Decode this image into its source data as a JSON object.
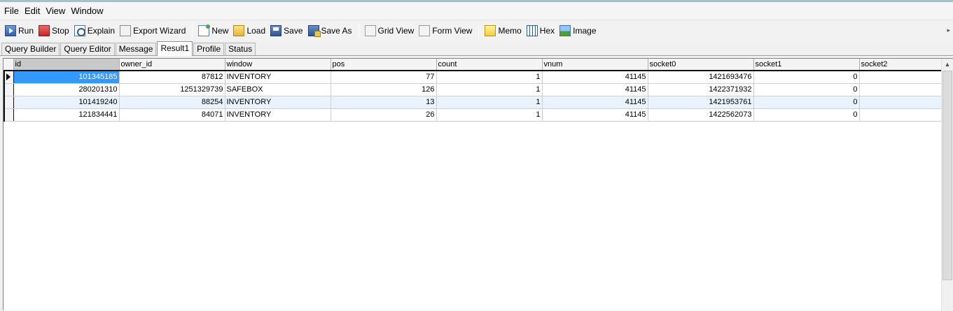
{
  "menu": [
    "File",
    "Edit",
    "View",
    "Window"
  ],
  "toolbar": {
    "run": "Run",
    "stop": "Stop",
    "explain": "Explain",
    "export_wizard": "Export Wizard",
    "new": "New",
    "load": "Load",
    "save": "Save",
    "save_as": "Save As",
    "grid_view": "Grid View",
    "form_view": "Form View",
    "memo": "Memo",
    "hex": "Hex",
    "image": "Image"
  },
  "tabs": [
    "Query Builder",
    "Query Editor",
    "Message",
    "Result1",
    "Profile",
    "Status"
  ],
  "active_tab": "Result1",
  "grid": {
    "columns": [
      "id",
      "owner_id",
      "window",
      "pos",
      "count",
      "vnum",
      "socket0",
      "socket1",
      "socket2"
    ],
    "rows": [
      [
        "101345185",
        "87812",
        "INVENTORY",
        "77",
        "1",
        "41145",
        "1421693476",
        "0",
        ""
      ],
      [
        "280201310",
        "1251329739",
        "SAFEBOX",
        "126",
        "1",
        "41145",
        "1422371932",
        "0",
        ""
      ],
      [
        "101419240",
        "88254",
        "INVENTORY",
        "13",
        "1",
        "41145",
        "1421953761",
        "0",
        ""
      ],
      [
        "121834441",
        "84071",
        "INVENTORY",
        "26",
        "1",
        "41145",
        "1422562073",
        "0",
        ""
      ]
    ]
  },
  "colors": {
    "selected_cell": "#3399ff",
    "alt_row": "#eaf3fb",
    "header_selected": "#c9c9c9"
  },
  "icons": [
    "run-icon",
    "stop-icon",
    "explain-icon",
    "export-wizard-icon",
    "new-icon",
    "load-icon",
    "save-icon",
    "save-as-icon",
    "grid-view-icon",
    "form-view-icon",
    "memo-icon",
    "hex-icon",
    "image-icon"
  ]
}
